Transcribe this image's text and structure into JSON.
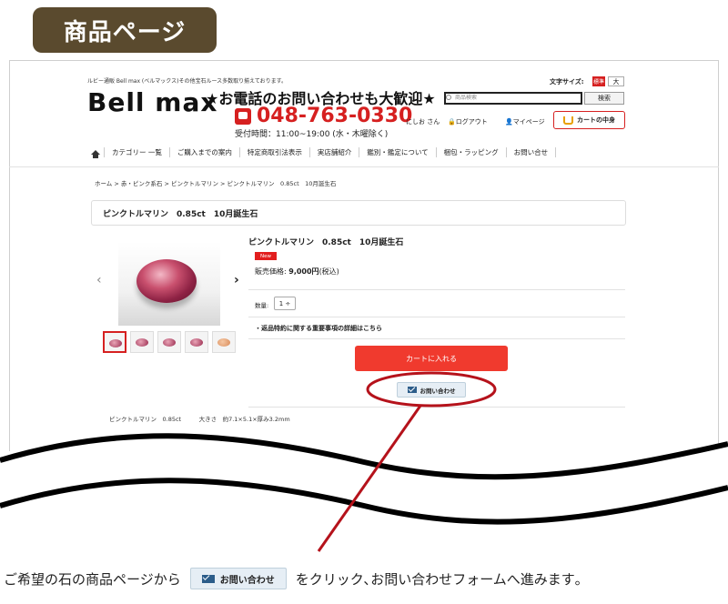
{
  "page_badge": "商品ページ",
  "header": {
    "tagline": "ルビー通販 Bell max (ベルマックス)その他宝石ルース多数取り揃えております。",
    "logo": "Bell max",
    "catchphrase": "★お電話のお問い合わせも大歓迎★",
    "phone": "048-763-0330",
    "hours": "受付時間：11:00~19:00 (水・木曜除く)",
    "font_size_label": "文字サイズ:",
    "font_size_standard": "標準",
    "font_size_large": "大",
    "search_placeholder": "商品検索",
    "search_button": "検索",
    "user": "にしお さん",
    "logout": "ログアウト",
    "mypage": "マイページ",
    "cart": "カートの中身"
  },
  "nav": {
    "items": [
      "カテゴリー 一覧",
      "ご購入までの案内",
      "特定商取引法表示",
      "実店舗紹介",
      "鑑別・鑑定について",
      "梱包・ラッピング",
      "お問い合せ"
    ]
  },
  "breadcrumb": "ホーム > 赤・ピンク系石 > ピンクトルマリン > ピンクトルマリン　0.85ct　10月誕生石",
  "product": {
    "name_box": "ピンクトルマリン　0.85ct　10月誕生石",
    "title": "ピンクトルマリン　0.85ct　10月誕生石",
    "badge": "New",
    "price_label": "販売価格:",
    "price_value": "9,000円",
    "price_tax": "(税込)",
    "qty_label": "数量:",
    "qty_value": "1 ÷",
    "returns_notice": "・返品特約に関する重要事項の詳細はこちら",
    "add_to_cart": "カートに入れる",
    "inquiry": "お問い合わせ",
    "spec": "ピンクトルマリン　0.85ct　　　大きさ　約7.1×5.1×厚み3.2mm"
  },
  "gallery": {
    "prev": "‹",
    "next": "›",
    "thumb_count": 5
  },
  "footer": {
    "before": "ご希望の石の商品ページから",
    "button": "お問い合わせ",
    "after": "をクリック､お問い合わせフォームへ進みます｡"
  },
  "colors": {
    "badge": "#5a4a2e",
    "accent_red": "#d62020",
    "cart_button": "#f03a2e",
    "highlight_ring": "#b5121b"
  }
}
